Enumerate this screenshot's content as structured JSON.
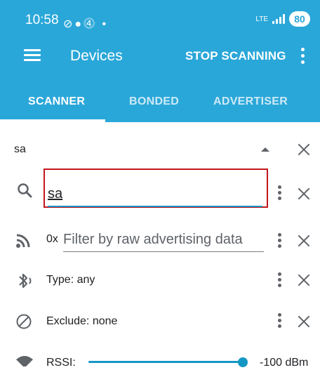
{
  "status_bar": {
    "time": "10:58",
    "left_icons": [
      "link-icon",
      "bag-icon",
      "dollar-circle-icon"
    ],
    "dot": "•",
    "network_label": "LTE",
    "battery": "80"
  },
  "app_bar": {
    "title": "Devices",
    "action": "STOP SCANNING"
  },
  "tabs": [
    {
      "label": "SCANNER",
      "active": true
    },
    {
      "label": "BONDED",
      "active": false
    },
    {
      "label": "ADVERTISER",
      "active": false
    }
  ],
  "filters": {
    "summary": "sa",
    "name_filter_value": "sa",
    "raw_prefix": "0x",
    "raw_placeholder": "Filter by raw advertising data",
    "type_label": "Type:  any",
    "exclude_label": "Exclude:  none",
    "rssi_label": "RSSI:",
    "rssi_value": "-100 dBm",
    "rssi_level": 1.0
  },
  "colors": {
    "primary": "#2aa7d9",
    "accent": "#1597c4",
    "highlight_border": "#c4161c"
  }
}
